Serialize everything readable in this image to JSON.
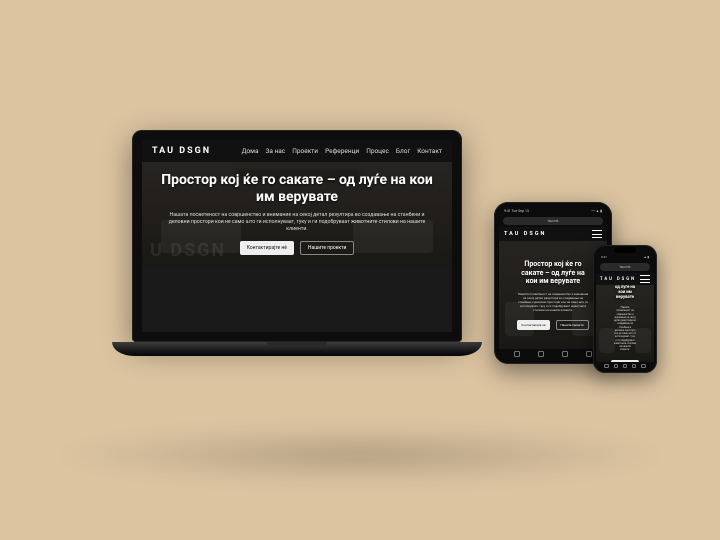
{
  "brand": {
    "logo": "TAU DSGN"
  },
  "nav": {
    "items": [
      {
        "label": "Дома"
      },
      {
        "label": "За нас"
      },
      {
        "label": "Проекти"
      },
      {
        "label": "Референци"
      },
      {
        "label": "Процес"
      },
      {
        "label": "Блог"
      },
      {
        "label": "Контакт"
      }
    ]
  },
  "hero": {
    "headline": "Простор кој ќе го сакате – од луѓе на кои им верувате",
    "sub": "Нашата посветеност на совршенство и внимание на секој детал резултира во создавање на станбени и деловни простори кои не само што ги исполнуваат, туку и ги подобруваат животните стилови на нашите клиенти.",
    "cta_primary": "Контактирајте нѐ",
    "cta_secondary": "Нашите проекти"
  },
  "watermark": "U DSGN",
  "statusbar": {
    "time": "9:41",
    "date": "Tue Sep 13",
    "signal_label": "Wi-Fi",
    "battery_label": "100%"
  },
  "browser": {
    "url": "tau.mk"
  }
}
